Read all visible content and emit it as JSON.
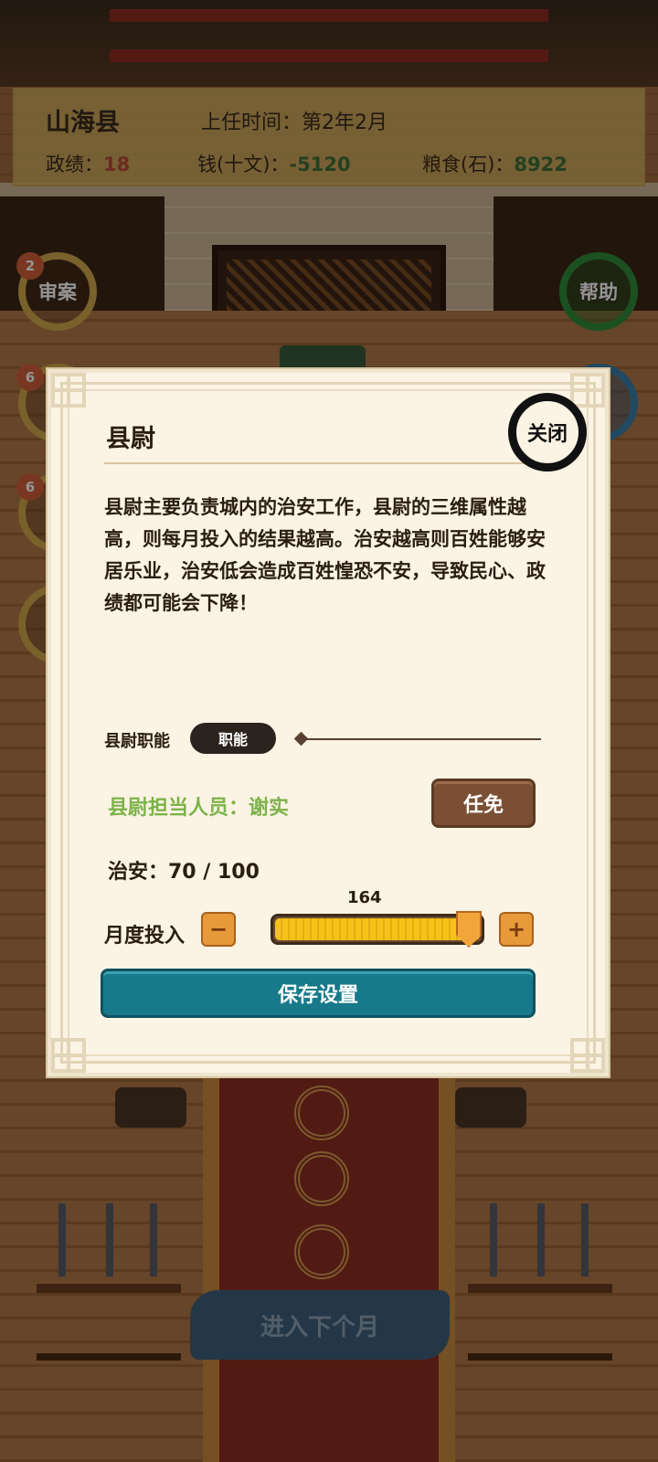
{
  "status_bar": {
    "county": "山海县",
    "tenure": "上任时间：第2年2月",
    "merit_label": "政绩：",
    "merit_value": "18",
    "money_label": "钱(十文)：",
    "money_value": "-5120",
    "grain_label": "粮食(石)：",
    "grain_value": "8922"
  },
  "side_buttons": {
    "trial": {
      "label": "审案",
      "badge": "2"
    },
    "help": {
      "label": "帮助"
    },
    "left2_badge": "6",
    "left3_badge": "6"
  },
  "dialog": {
    "title": "县尉",
    "close_label": "关闭",
    "description": "县尉主要负责城内的治安工作，县尉的三维属性越高，则每月投入的结果越高。治安越高则百姓能够安居乐业，治安低会造成百姓惶恐不安，导致民心、政绩都可能会下降！",
    "duty_label": "县尉职能",
    "duty_button": "职能",
    "assignee": "县尉担当人员：谢实",
    "appoint_button": "任免",
    "security": "治安：70 / 100",
    "slider_value": "164",
    "slider_fill_fraction": 1.0,
    "monthly_label": "月度投入",
    "minus_label": "−",
    "plus_label": "+",
    "save_button": "保存设置"
  },
  "bottom": {
    "next_month": "进入下个月"
  },
  "colors": {
    "merit_red": "#b84a3a",
    "resource_green": "#3f6e3a",
    "assignee_green": "#7db34a",
    "save_teal": "#17798a",
    "appoint_brown": "#7a4f33"
  }
}
